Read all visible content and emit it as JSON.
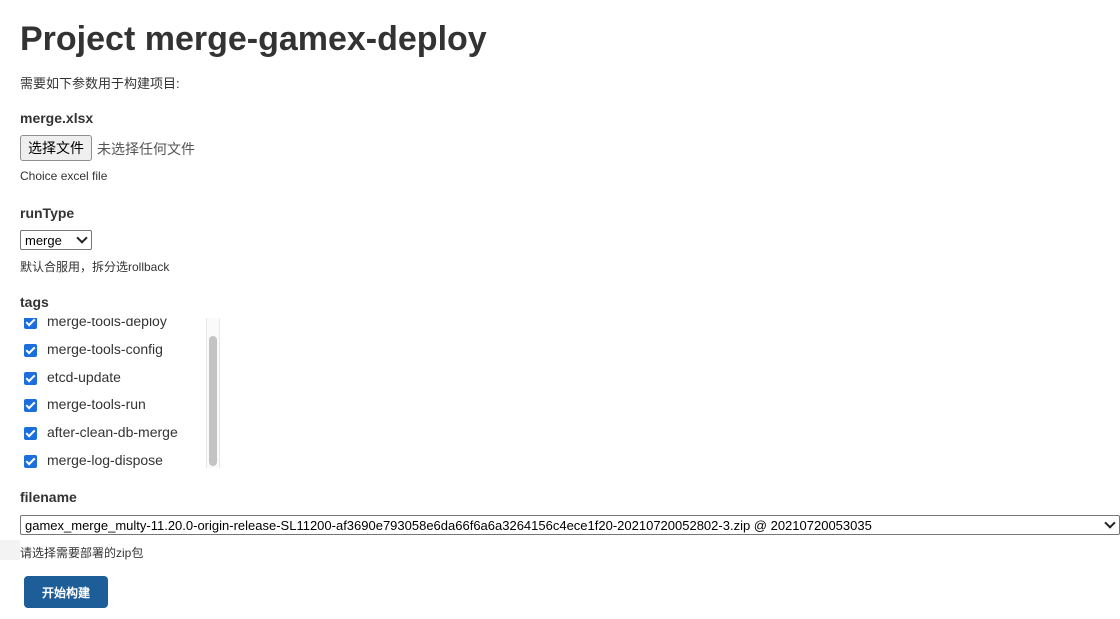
{
  "page": {
    "title": "Project merge-gamex-deploy",
    "intro": "需要如下参数用于构建项目:"
  },
  "params": {
    "file": {
      "label": "merge.xlsx",
      "button_label": "选择文件",
      "status": "未选择任何文件",
      "description": "Choice excel file"
    },
    "runType": {
      "label": "runType",
      "selected": "merge",
      "description": "默认合服用，拆分选rollback"
    },
    "tags": {
      "label": "tags",
      "items": [
        {
          "label": "merge-tools-deploy",
          "checked": true
        },
        {
          "label": "merge-tools-config",
          "checked": true
        },
        {
          "label": "etcd-update",
          "checked": true
        },
        {
          "label": "merge-tools-run",
          "checked": true
        },
        {
          "label": "after-clean-db-merge",
          "checked": true
        },
        {
          "label": "merge-log-dispose",
          "checked": true
        }
      ]
    },
    "filename": {
      "label": "filename",
      "selected": "gamex_merge_multy-11.20.0-origin-release-SL11200-af3690e793058e6da66f6a6a3264156c4ece1f20-20210720052802-3.zip @ 20210720053035",
      "description": "请选择需要部署的zip包"
    }
  },
  "actions": {
    "build_label": "开始构建"
  },
  "colors": {
    "checkbox": "#1a6fdc",
    "build_button": "#1d5e99"
  }
}
